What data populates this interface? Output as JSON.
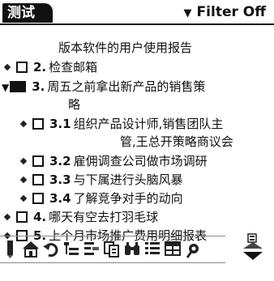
{
  "header": {
    "category": "测试",
    "filter_label": "Filter Off"
  },
  "list": {
    "title": "版本软件的用户使用报告",
    "items": [
      {
        "num": "2.",
        "text": "检查邮箱"
      },
      {
        "num": "3.",
        "text": "周五之前拿出新产品的销售策"
      },
      {
        "num": "",
        "text": "略"
      },
      {
        "num": "3.1",
        "text": "组织产品设计师,销售团队主"
      },
      {
        "num": "",
        "text": "管,王总开策略商议会"
      },
      {
        "num": "3.2",
        "text": "雇佣调查公司做市场调研"
      },
      {
        "num": "3.3",
        "text": "与下属进行头脑风暴"
      },
      {
        "num": "3.4",
        "text": "了解竞争对手的动向"
      },
      {
        "num": "4.",
        "text": "哪天有空去打羽毛球"
      },
      {
        "num": "5.",
        "text": "上个月市场推广费用明细报表"
      }
    ]
  },
  "toolbar": {
    "icons": [
      "pencil-icon",
      "home-icon",
      "undo-icon",
      "indent-icon",
      "outdent-icon",
      "copy-icon",
      "find-icon",
      "list-icon",
      "grid-icon",
      "tools-icon"
    ]
  },
  "colors": {
    "text": "#111111",
    "tab_bg": "#111111",
    "tab_text": "#ffffff"
  }
}
